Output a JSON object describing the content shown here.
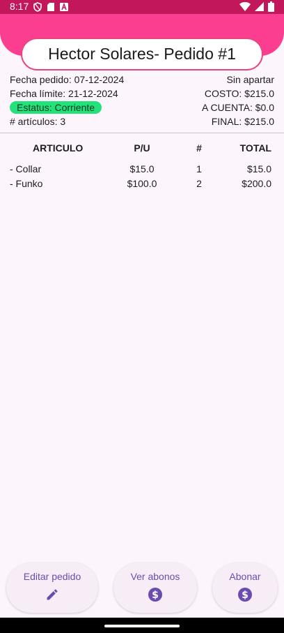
{
  "status_bar": {
    "time": "8:17",
    "icons": [
      "shield-icon",
      "sd-card-icon",
      "a-badge-icon",
      "wifi-icon",
      "signal-icon",
      "battery-icon"
    ]
  },
  "header": {
    "title": "Hector Solares- Pedido #1",
    "color": "#fb3e8f"
  },
  "order_info": {
    "fecha_pedido": "Fecha pedido: 07-12-2024",
    "fecha_limite": "Fecha límite: 21-12-2024",
    "estatus": "Estatus: Corriente",
    "articulos": "# artículos: 3",
    "apartado": "Sin apartar",
    "costo": "COSTO: $215.0",
    "a_cuenta": "A CUENTA: $0.0",
    "final": "FINAL: $215.0"
  },
  "table": {
    "headers": [
      "ARTICULO",
      "P/U",
      "#",
      "TOTAL"
    ],
    "rows": [
      [
        "- Collar",
        "$15.0",
        "1",
        "$15.0"
      ],
      [
        "- Funko",
        "$100.0",
        "2",
        "$200.0"
      ]
    ]
  },
  "actions": [
    {
      "label": "Editar pedido",
      "icon": "pencil-icon"
    },
    {
      "label": "Ver abonos",
      "icon": "dollar-circle-icon"
    },
    {
      "label": "Abonar",
      "icon": "dollar-circle-icon"
    }
  ],
  "colors": {
    "accent": "#6c4bb0",
    "status_badge": "#22e279",
    "status_bar": "#c2185b"
  }
}
